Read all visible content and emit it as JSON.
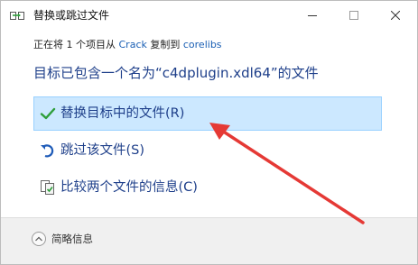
{
  "window": {
    "title": "替换或跳过文件",
    "icon": "copy-file-icon"
  },
  "title_buttons": {
    "minimize": "minimize-icon",
    "maximize": "maximize-icon",
    "close": "close-icon"
  },
  "info": {
    "prefix": "正在将 1 个项目从 ",
    "source": "Crack",
    "middle": " 复制到 ",
    "destination": "corelibs"
  },
  "heading": "目标已包含一个名为“c4dplugin.xdl64”的文件",
  "options": [
    {
      "label": "替换目标中的文件(R)",
      "icon": "check-icon",
      "selected": true
    },
    {
      "label": "跳过该文件(S)",
      "icon": "skip-icon",
      "selected": false
    },
    {
      "label": "比较两个文件的信息(C)",
      "icon": "compare-files-icon",
      "selected": false
    }
  ],
  "footer": {
    "details_label": "简略信息",
    "details_icon": "chevron-up-icon"
  },
  "colors": {
    "heading": "#1e3f8a",
    "selected_bg": "#cce8ff",
    "selected_border": "#99d1ff",
    "link": "#1a5fb4",
    "check": "#2e9e3a",
    "arrow": "#e53935"
  }
}
